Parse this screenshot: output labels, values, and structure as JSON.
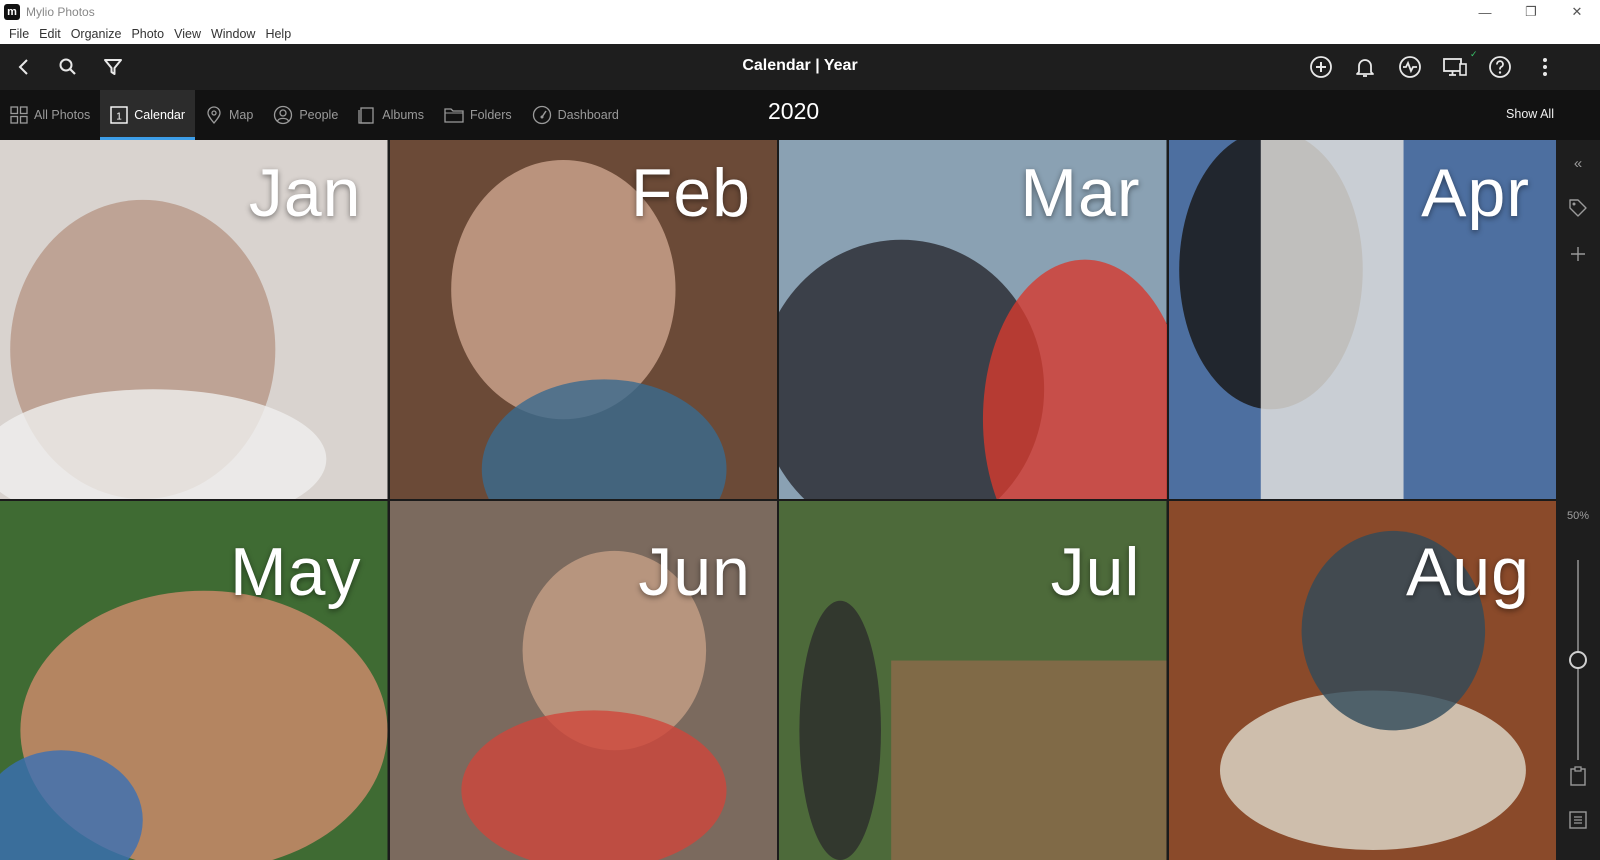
{
  "window": {
    "title": "Mylio Photos",
    "logo_letter": "m",
    "controls": {
      "minimize": "—",
      "restore": "❐",
      "close": "✕"
    }
  },
  "menu": [
    "File",
    "Edit",
    "Organize",
    "Photo",
    "View",
    "Window",
    "Help"
  ],
  "toolbar": {
    "title": "Calendar | Year",
    "left_icons": [
      "back-icon",
      "search-icon",
      "filter-icon"
    ],
    "right_icons": [
      "add-icon",
      "bell-icon",
      "activity-icon",
      "devices-icon",
      "help-icon",
      "more-icon"
    ],
    "sync_check": "✓"
  },
  "nav": {
    "tabs": [
      {
        "label": "All Photos",
        "icon": "grid-icon",
        "active": false
      },
      {
        "label": "Calendar",
        "icon": "calendar-icon",
        "active": true
      },
      {
        "label": "Map",
        "icon": "map-pin-icon",
        "active": false
      },
      {
        "label": "People",
        "icon": "person-icon",
        "active": false
      },
      {
        "label": "Albums",
        "icon": "album-icon",
        "active": false
      },
      {
        "label": "Folders",
        "icon": "folder-icon",
        "active": false
      },
      {
        "label": "Dashboard",
        "icon": "dashboard-icon",
        "active": false
      }
    ],
    "calendar_day": "1",
    "year": "2020",
    "show_all": "Show All"
  },
  "months": [
    {
      "label": "Jan",
      "colors": [
        "#d9d3cf",
        "#b99a8b",
        "#efefed"
      ]
    },
    {
      "label": "Feb",
      "colors": [
        "#6b4a37",
        "#c8a08a",
        "#3a6a8f"
      ]
    },
    {
      "label": "Mar",
      "colors": [
        "#8aa1b3",
        "#2d2f36",
        "#d63a2e"
      ]
    },
    {
      "label": "Apr",
      "colors": [
        "#4d6fa0",
        "#1a1a1a",
        "#e9e6e1"
      ]
    },
    {
      "label": "May",
      "colors": [
        "#3f6b33",
        "#c98a6a",
        "#3a6fb5"
      ]
    },
    {
      "label": "Jun",
      "colors": [
        "#7b6a5e",
        "#c29c84",
        "#d0463b"
      ]
    },
    {
      "label": "Jul",
      "colors": [
        "#4d6a3a",
        "#8a6a4a",
        "#2c2c2c"
      ]
    },
    {
      "label": "Aug",
      "colors": [
        "#8a4a2a",
        "#d9d2c3",
        "#2f4a5a"
      ]
    }
  ],
  "sidebar": {
    "collapse": "«",
    "zoom_percent": "50%",
    "zoom_level": 0.5
  }
}
